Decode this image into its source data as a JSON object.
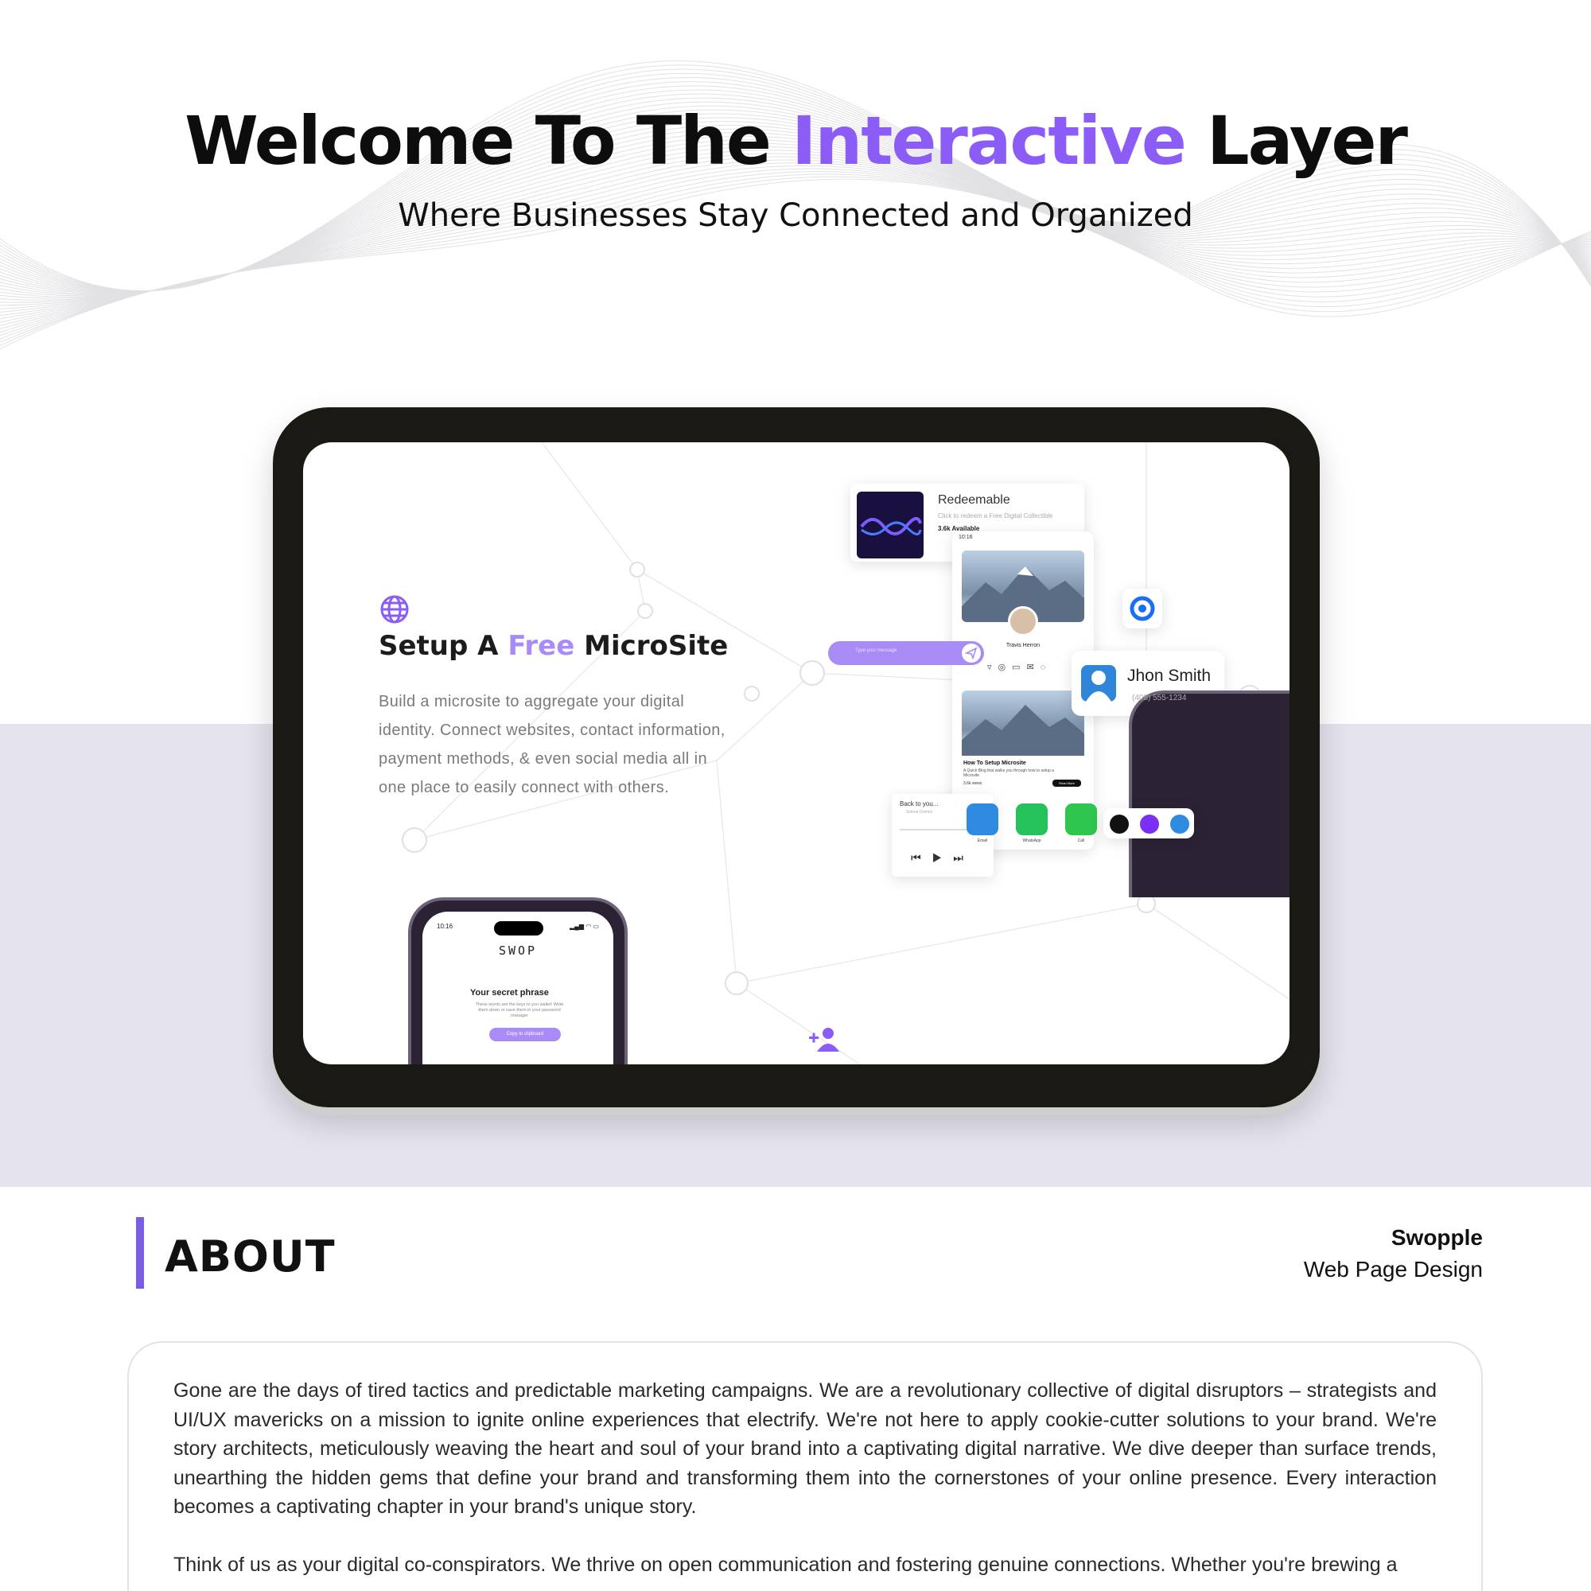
{
  "hero": {
    "title_pre": "Welcome To The ",
    "title_accent": "Interactive",
    "title_post": " Layer",
    "subtitle": "Where Businesses Stay Connected and Organized"
  },
  "colors": {
    "accent": "#8b5cf6",
    "accent_light": "#a98bf5",
    "band": "#e4e3ee",
    "about_bar": "#7c5ce6"
  },
  "tablet": {
    "microsite_title_pre": "Setup A ",
    "microsite_title_accent": "Free",
    "microsite_title_post": " MicroSite",
    "microsite_desc": "Build a microsite to aggregate your digital identity. Connect websites, contact information, payment methods, & even social media all in one place to easily connect with others.",
    "globe_icon": "globe-icon",
    "redeem_card": {
      "title": "Redeemable",
      "meta": "Click to redeem a Free Digital Collectible",
      "available": "3.6k  Available"
    },
    "mini_phone": {
      "time": "10:16",
      "name": "Travis Herron",
      "blog_title": "How To Setup Microsite",
      "blog_sub": "A Quick Blog that walks you through how to setup a Microsite",
      "views": "3.6k views",
      "read_more": "Read More"
    },
    "search_placeholder": "Type your message",
    "contact": {
      "name": "Jhon Smith",
      "phone": "(408) 555-1234"
    },
    "music": {
      "title": "Back to you...",
      "artist": "Selena Gomez"
    },
    "apps": [
      {
        "label": "Email",
        "icon": "mail-icon",
        "color": "#2f8be0"
      },
      {
        "label": "WhatsApp",
        "icon": "whatsapp-icon",
        "color": "#25c15b"
      },
      {
        "label": "Call",
        "icon": "phone-icon",
        "color": "#2ec64f"
      }
    ],
    "swop_phone": {
      "time": "10:16",
      "brand": "SWOP",
      "secret_title": "Your secret phrase",
      "secret_desc": "These words are the keys to you wallet! Write them down or save them in your password manager",
      "copy_button": "Copy to clipboard"
    }
  },
  "about": {
    "heading": "ABOUT",
    "client": "Swopple",
    "project_type": "Web Page Design",
    "paragraph1": "Gone are the days of tired tactics and predictable marketing campaigns. We are a revolutionary collective of digital disruptors – strategists and UI/UX mavericks on a mission to ignite online experiences that electrify. We're not here to apply cookie-cutter solutions to your brand. We're story architects, meticulously weaving the heart and soul of your brand into a captivating digital narrative. We dive deeper than surface trends, unearthing the hidden gems that define your brand and transforming them into the cornerstones of your online presence. Every interaction becomes a captivating chapter in your brand's unique story.",
    "paragraph2": "Think of us as your digital co-conspirators. We thrive on open communication and fostering genuine connections. Whether you're brewing a"
  }
}
